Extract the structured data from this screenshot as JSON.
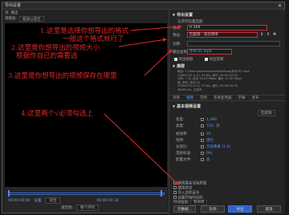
{
  "window": {
    "title": "导出设置",
    "close": "✕"
  },
  "source": {
    "row1a": "源缩放:",
    "row1b": "缩放以适合",
    "row1c": "源",
    "row1d": "输出"
  },
  "timeline": {
    "start_time": "00:00:00:00",
    "end_time": "00:00:00:34",
    "range_label": "源范围:",
    "range_value": "整个序列",
    "aspect_label": "设置",
    "aspect_value": "适合"
  },
  "right": {
    "export_settings": "导出设置",
    "match_seq": "与序列设置匹配",
    "format_label": "格式:",
    "format_value": "H.264",
    "preset_label": "预设:",
    "preset_value": "匹配源 - 高比特率",
    "comment_label": "注释:",
    "output_label": "输出名称:",
    "output_value": "序列 01.mp4",
    "export_video": "导出视频",
    "export_audio": "导出音频",
    "summary_title": "摘要",
    "summary_out": "输出: C:\\Users\\Administrator\\Desktop\\序列 01.mp4",
    "summary_out2": "1280x720 (1.0), 25 fps, 逐行, 00:00:00:34",
    "summary_out3": "VBR, 1 次, 目标 10.00 Mbps, 最大 12.00 Mbps",
    "summary_src": "源: 序列, 序列 01",
    "summary_src2": "1280x720 (1.0), 25 fps, 逐行, 00:00:00:34",
    "summary_src3": "48000 Hz, 立体声"
  },
  "tabs": [
    "效果",
    "视频",
    "音频",
    "多路复用器",
    "字幕",
    "发布"
  ],
  "video": {
    "section": "基本视频设置",
    "match_source": "匹配源",
    "width_label": "宽度:",
    "width_value": "1,280",
    "height_label": "高度:",
    "height_value": "720",
    "fps_label": "帧速率:",
    "fps_value": "25",
    "field_label": "场序:",
    "field_value": "逐行",
    "aspect_label": "长宽比:",
    "aspect_value": "方形像素 (1.0)",
    "tv_label": "电视标准:",
    "tv_value": "PAL",
    "profile_label": "配置文件:",
    "profile_value": "高"
  },
  "options": {
    "max_quality": "使用最高渲染质量",
    "preview": "使用预览",
    "import_proj": "导入到项目中",
    "set_start": "设置开始时间码",
    "time_interp_label": "时间插值:",
    "time_interp_value": "帧采样",
    "file_size_label": "估计文件大小:",
    "file_size_value": "0 MB"
  },
  "buttons": {
    "metadata": "元数据...",
    "queue": "队列",
    "export": "导出",
    "cancel": "取消"
  },
  "annotations": {
    "a1_line1": "1.这里是选择你想导出的格式",
    "a1_line2": "一般这个格式就行了",
    "a2_line1": "2.这里是你想导出的视频大小",
    "a2_line2": "根据你自己的需要选",
    "a3": "3.这里是你想导出的视频保存在哪里",
    "a4": "4.这里两个√必须勾选上"
  },
  "colors": {
    "accent": "#5a9bff",
    "annotation": "#e02828",
    "primary_button": "#2f63c7"
  }
}
